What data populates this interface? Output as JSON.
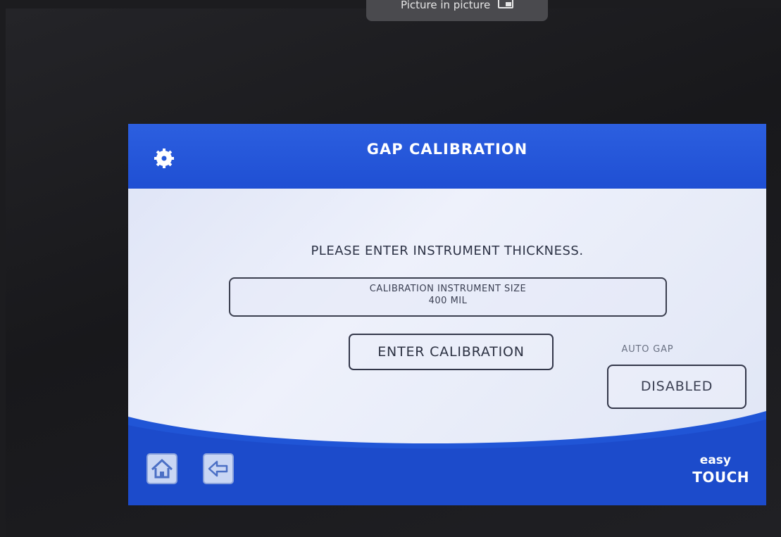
{
  "overlay": {
    "pip_label": "Picture in picture"
  },
  "screen": {
    "title": "GAP CALIBRATION",
    "prompt": "PLEASE ENTER INSTRUMENT THICKNESS.",
    "instrument_size": {
      "label": "CALIBRATION INSTRUMENT SIZE",
      "value": "400 MIL"
    },
    "enter_button_label": "ENTER CALIBRATION",
    "auto_gap": {
      "label": "AUTO GAP",
      "value": "DISABLED"
    }
  },
  "footer": {
    "brand_top": "easy",
    "brand_bottom": "TOUCH"
  },
  "icons": [
    "gear-icon",
    "home-icon",
    "back-arrow-icon"
  ],
  "colors": {
    "accent": "#2258d8",
    "panel": "#e7ebf8",
    "text": "#2d3346"
  }
}
